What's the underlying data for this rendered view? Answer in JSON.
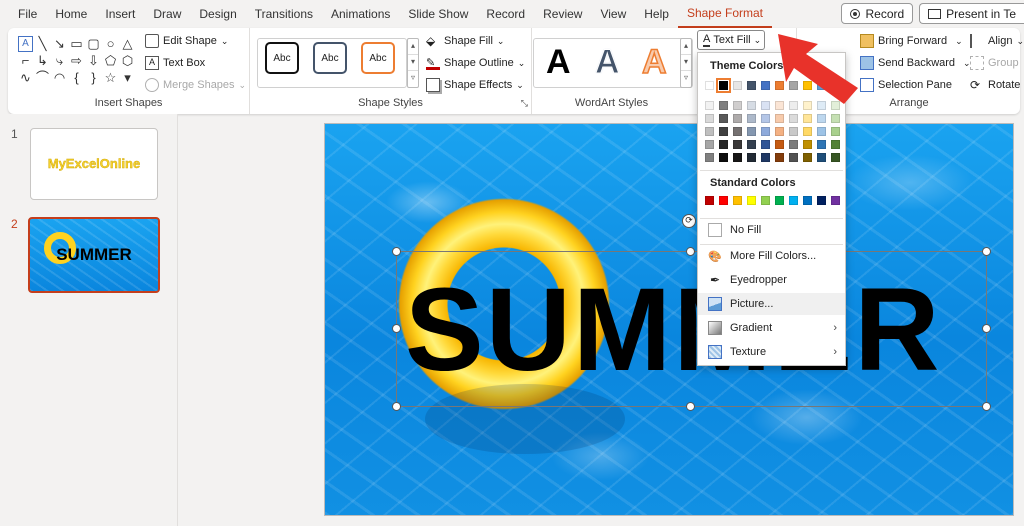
{
  "menu": {
    "items": [
      "File",
      "Home",
      "Insert",
      "Draw",
      "Design",
      "Transitions",
      "Animations",
      "Slide Show",
      "Record",
      "Review",
      "View",
      "Help",
      "Shape Format"
    ],
    "record_label": "Record",
    "present_label": "Present in Te"
  },
  "ribbon": {
    "insert_shapes": {
      "label": "Insert Shapes",
      "edit_shape": "Edit Shape",
      "text_box": "Text Box",
      "merge_shapes": "Merge Shapes"
    },
    "shape_styles": {
      "label": "Shape Styles",
      "style_sample": "Abc",
      "shape_fill": "Shape Fill",
      "shape_outline": "Shape Outline",
      "shape_effects": "Shape Effects"
    },
    "wordart": {
      "label": "WordArt Styles",
      "sample": "A",
      "text_fill": "Text Fill"
    },
    "arrange": {
      "label": "Arrange",
      "bring_forward": "Bring Forward",
      "send_backward": "Send Backward",
      "selection_pane": "Selection Pane",
      "align": "Align",
      "group": "Group",
      "rotate": "Rotate"
    }
  },
  "slides": [
    {
      "number": "1",
      "text": "MyExcelOnline"
    },
    {
      "number": "2",
      "text": "SUMMER"
    }
  ],
  "slide": {
    "text": "SUMMER"
  },
  "dropdown": {
    "theme_colors_title": "Theme Colors",
    "standard_colors_title": "Standard Colors",
    "no_fill": "No Fill",
    "more_fill_colors": "More Fill Colors...",
    "eyedropper": "Eyedropper",
    "picture": "Picture...",
    "gradient": "Gradient",
    "texture": "Texture",
    "theme_top": [
      "#ffffff",
      "#000000",
      "#e7e6e6",
      "#44546a",
      "#4472c4",
      "#ed7d31",
      "#a5a5a5",
      "#ffc000",
      "#5b9bd5",
      "#70ad47"
    ],
    "theme_columns": [
      [
        "#f2f2f2",
        "#d9d9d9",
        "#bfbfbf",
        "#a6a6a6",
        "#808080"
      ],
      [
        "#7f7f7f",
        "#595959",
        "#404040",
        "#262626",
        "#0d0d0d"
      ],
      [
        "#d0cece",
        "#aeabab",
        "#757171",
        "#3a3838",
        "#171616"
      ],
      [
        "#d6dce4",
        "#adb9ca",
        "#8497b0",
        "#333f4f",
        "#222a35"
      ],
      [
        "#d9e2f3",
        "#b4c6e7",
        "#8eaadb",
        "#2f5496",
        "#1f3864"
      ],
      [
        "#fbe5d5",
        "#f7cbac",
        "#f4b183",
        "#c55a11",
        "#833c0b"
      ],
      [
        "#ededed",
        "#dbdbdb",
        "#c9c9c9",
        "#7b7b7b",
        "#525252"
      ],
      [
        "#fff2cc",
        "#ffe599",
        "#ffd966",
        "#bf8f00",
        "#7f6000"
      ],
      [
        "#deebf6",
        "#bdd7ee",
        "#9dc3e6",
        "#2e75b5",
        "#1e4e79"
      ],
      [
        "#e2efd9",
        "#c5e0b3",
        "#a8d08d",
        "#538135",
        "#375623"
      ]
    ],
    "standard": [
      "#c00000",
      "#ff0000",
      "#ffc000",
      "#ffff00",
      "#92d050",
      "#00b050",
      "#00b0f0",
      "#0070c0",
      "#002060",
      "#7030a0"
    ]
  },
  "colors": {
    "accent": "#c43e1c",
    "arrow": "#e8322a"
  }
}
